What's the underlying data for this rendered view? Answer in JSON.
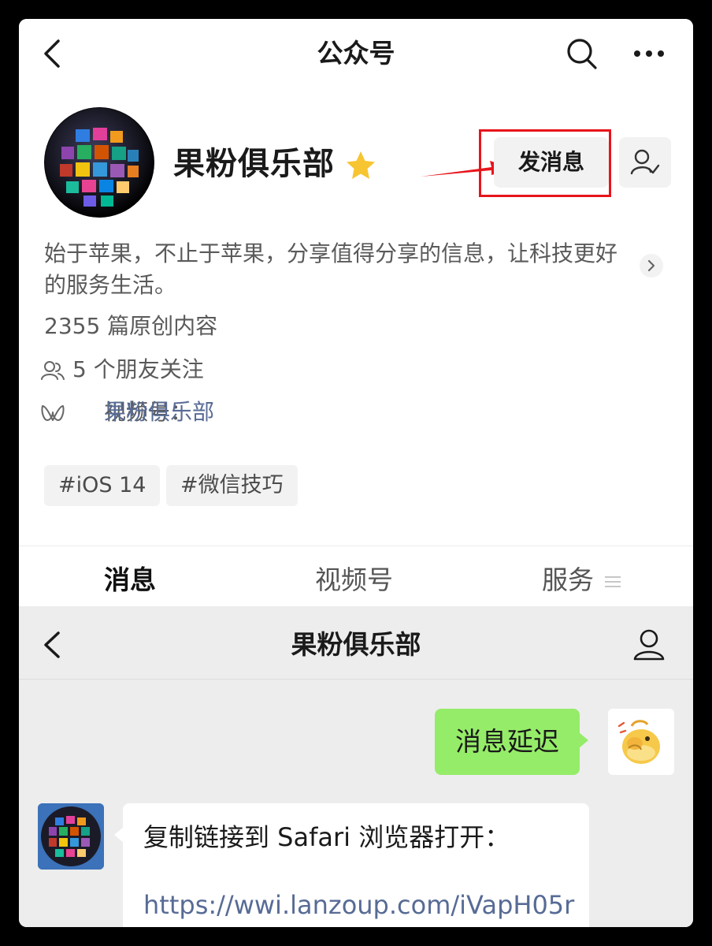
{
  "header": {
    "title": "公众号"
  },
  "account": {
    "name": "果粉俱乐部",
    "send_message_label": "发消息",
    "description": "始于苹果，不止于苹果，分享值得分享的信息，让科技更好的服务生活。",
    "original_count": "2355 篇原创内容",
    "friends_following": "5 个朋友关注",
    "channels_prefix": "视频号：",
    "channels_name": "果粉俱乐部",
    "tags": [
      "#iOS 14",
      "#微信技巧"
    ]
  },
  "tabs": [
    {
      "label": "消息",
      "active": true
    },
    {
      "label": "视频号",
      "active": false
    },
    {
      "label": "服务",
      "active": false
    }
  ],
  "chat": {
    "title": "果粉俱乐部",
    "messages": [
      {
        "from": "me",
        "text": "消息延迟"
      },
      {
        "from": "them",
        "lines": [
          "复制链接到 Safari 浏览器打开：",
          "https://wwi.lanzoup.com/iVapH05r"
        ]
      }
    ]
  },
  "colors": {
    "accent_link": "#576b95",
    "sent_bubble": "#95ec69",
    "highlight_box": "#e8141b",
    "star": "#f7c531"
  },
  "icons": [
    "back-icon",
    "search-icon",
    "more-icon",
    "star-icon",
    "user-check-icon",
    "chevron-right-icon",
    "friends-icon",
    "channels-icon",
    "menu-icon",
    "person-icon"
  ]
}
